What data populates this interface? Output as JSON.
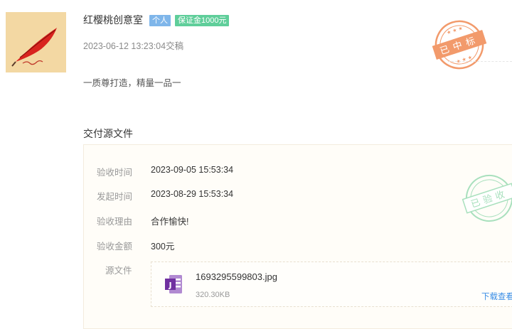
{
  "header": {
    "shop_name": "红樱桃创意室",
    "tags": [
      "个人",
      "保证金1000元"
    ],
    "submit_time": "2023-06-12 13:23:04交稿",
    "stamp_win": "已中标"
  },
  "description": "一质尊打造，精量一品一",
  "delivery": {
    "section_title": "交付源文件",
    "rows": [
      {
        "label": "验收时间",
        "value": "2023-09-05 15:53:34"
      },
      {
        "label": "发起时间",
        "value": "2023-08-29 15:53:34"
      },
      {
        "label": "验收理由",
        "value": "合作愉快!"
      },
      {
        "label": "验收金额",
        "value": "300元"
      }
    ],
    "file_label": "源文件",
    "file": {
      "name": "1693295599803.jpg",
      "size": "320.30KB",
      "action": "下载查看"
    },
    "stamp_accept": "已验收"
  },
  "colors": {
    "tag_personal": "#7fb6ea",
    "tag_deposit": "#5fce9a",
    "stamp_win": "#f29a6b",
    "stamp_accept": "#a8e0bd",
    "link": "#3a8ee6"
  }
}
